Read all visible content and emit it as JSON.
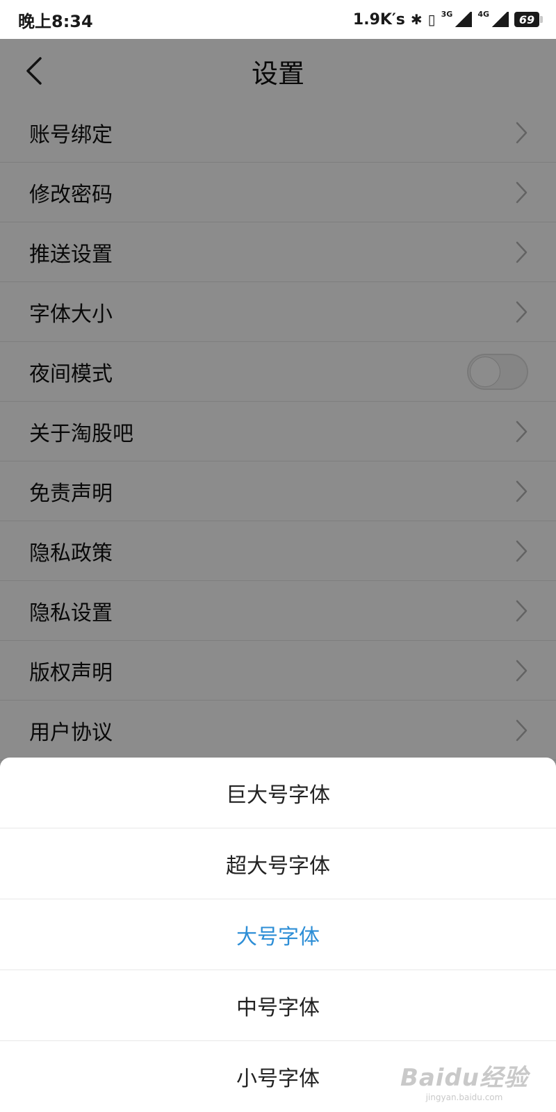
{
  "status_bar": {
    "time": "晚上8:34",
    "speed": "1.9K′s",
    "network_a": "3G",
    "network_b": "4G",
    "battery": "69"
  },
  "nav": {
    "title": "设置",
    "back_icon": "chevron-left-icon"
  },
  "settings_items": [
    {
      "label": "账号绑定",
      "control": "chevron"
    },
    {
      "label": "修改密码",
      "control": "chevron"
    },
    {
      "label": "推送设置",
      "control": "chevron"
    },
    {
      "label": "字体大小",
      "control": "chevron"
    },
    {
      "label": "夜间模式",
      "control": "toggle",
      "on": false
    },
    {
      "label": "关于淘股吧",
      "control": "chevron"
    },
    {
      "label": "免责声明",
      "control": "chevron"
    },
    {
      "label": "隐私政策",
      "control": "chevron"
    },
    {
      "label": "隐私设置",
      "control": "chevron"
    },
    {
      "label": "版权声明",
      "control": "chevron"
    },
    {
      "label": "用户协议",
      "control": "chevron"
    }
  ],
  "font_sheet": {
    "options": [
      "巨大号字体",
      "超大号字体",
      "大号字体",
      "中号字体",
      "小号字体"
    ],
    "selected_index": 2,
    "selected_color": "#2d8ed6"
  },
  "watermark": {
    "main": "Baidu经验",
    "sub": "jingyan.baidu.com"
  }
}
